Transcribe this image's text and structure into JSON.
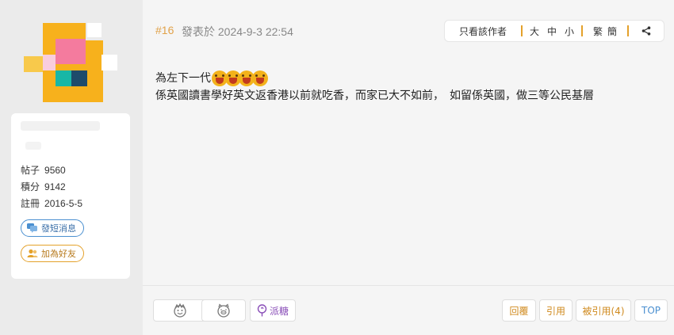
{
  "author": {
    "avatar_colors": [
      "#f7b11c",
      "#f47b9e",
      "#f9cddd",
      "#18b7a6",
      "#1e4b6b",
      "#f8c94b"
    ],
    "stats": [
      {
        "label": "帖子",
        "value": "9560"
      },
      {
        "label": "積分",
        "value": "9142"
      },
      {
        "label": "註冊",
        "value": "2016-5-5"
      }
    ],
    "message_label": "發短消息",
    "add_friend_label": "加為好友"
  },
  "post": {
    "number": "#16",
    "time": "發表於 2024-9-3 22:54",
    "toolbar": {
      "only_author": "只看該作者",
      "size_large": "大",
      "size_medium": "中",
      "size_small": "小",
      "traditional": "繁",
      "simplified": "簡",
      "share_icon": "share-icon"
    },
    "line1": "為左下一代",
    "emoji_count": 4,
    "line2": "係英國讀書學好英文返香港以前就吃香，而家已大不如前，　如留係英國，做三等公民基層"
  },
  "footer": {
    "tip_label": "派糖",
    "reply_label": "回覆",
    "quote_label": "引用",
    "quoted_label": "被引用(4)",
    "top_label": "TOP"
  }
}
